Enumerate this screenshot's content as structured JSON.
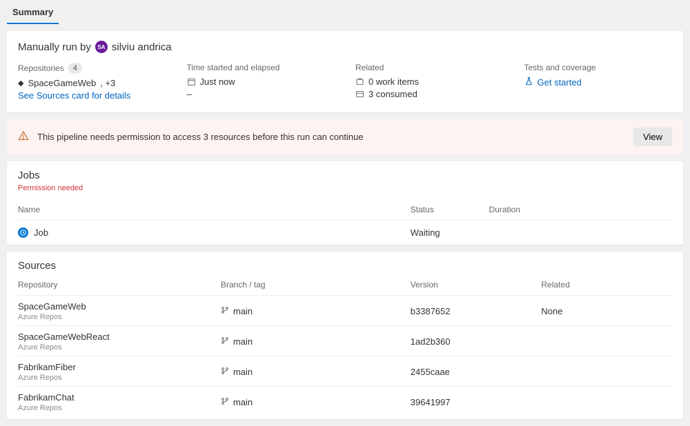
{
  "tabs": {
    "summary": "Summary"
  },
  "runBy": {
    "prefix": "Manually run by",
    "initials": "SA",
    "user": "silviu andrica"
  },
  "cols": {
    "repos": {
      "label": "Repositories",
      "count": "4",
      "repo": "SpaceGameWeb",
      "more": ", +3",
      "link": "See Sources card for details"
    },
    "time": {
      "label": "Time started and elapsed",
      "value": "Just now",
      "elapsed": "–"
    },
    "related": {
      "label": "Related",
      "work": "0 work items",
      "consumed": "3 consumed"
    },
    "tests": {
      "label": "Tests and coverage",
      "link": "Get started"
    }
  },
  "alert": {
    "text": "This pipeline needs permission to access 3 resources before this run can continue",
    "button": "View"
  },
  "jobs": {
    "title": "Jobs",
    "permission": "Permission needed",
    "headers": {
      "name": "Name",
      "status": "Status",
      "duration": "Duration"
    },
    "rows": [
      {
        "name": "Job",
        "status": "Waiting",
        "duration": ""
      }
    ]
  },
  "sources": {
    "title": "Sources",
    "headers": {
      "repo": "Repository",
      "branch": "Branch / tag",
      "version": "Version",
      "related": "Related"
    },
    "rows": [
      {
        "name": "SpaceGameWeb",
        "sub": "Azure Repos",
        "branch": "main",
        "version": "b3387652",
        "related": "None"
      },
      {
        "name": "SpaceGameWebReact",
        "sub": "Azure Repos",
        "branch": "main",
        "version": "1ad2b360",
        "related": ""
      },
      {
        "name": "FabrikamFiber",
        "sub": "Azure Repos",
        "branch": "main",
        "version": "2455caae",
        "related": ""
      },
      {
        "name": "FabrikamChat",
        "sub": "Azure Repos",
        "branch": "main",
        "version": "39641997",
        "related": ""
      }
    ]
  }
}
